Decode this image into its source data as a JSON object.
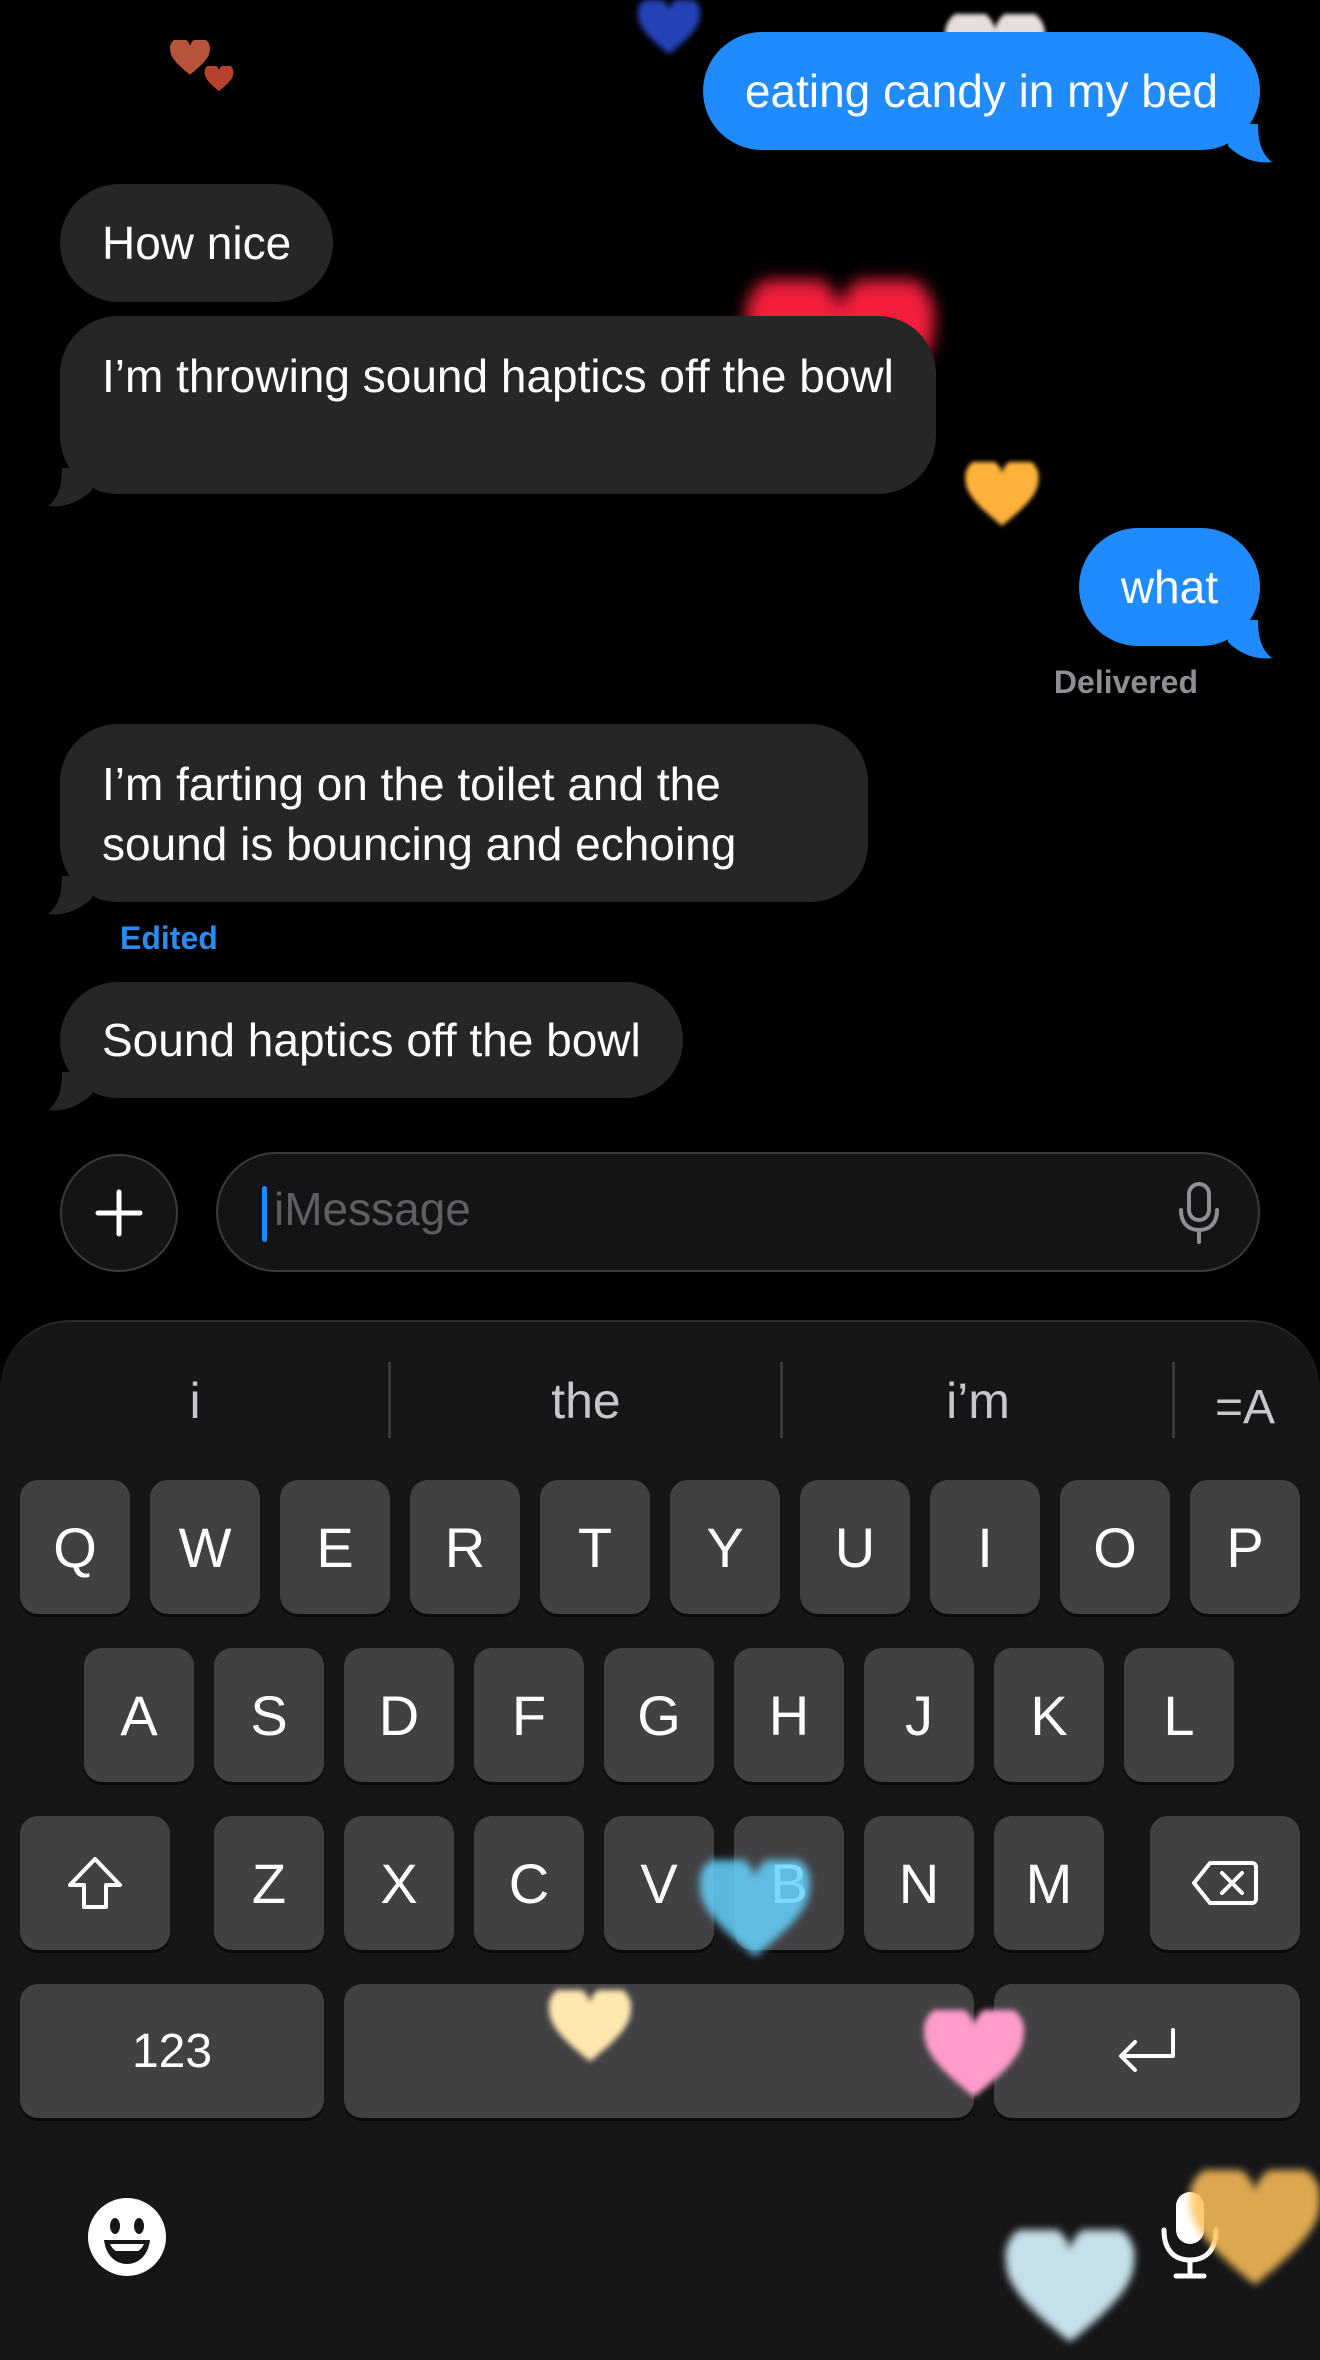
{
  "messages": [
    {
      "direction": "outgoing",
      "text": "eating candy in my bed"
    },
    {
      "direction": "incoming",
      "text": "How nice"
    },
    {
      "direction": "incoming",
      "text": "I’m throwing sound haptics off the bowl"
    },
    {
      "direction": "outgoing",
      "text": "what"
    },
    {
      "direction": "incoming",
      "text": "I’m farting on the toilet and the sound is bouncing and echoing"
    },
    {
      "direction": "incoming",
      "text": "Sound haptics off the bowl"
    }
  ],
  "delivered_label": "Delivered",
  "edited_label": "Edited",
  "compose": {
    "placeholder": "iMessage",
    "plus_icon": "plus-icon",
    "mic_icon": "microphone-icon"
  },
  "keyboard": {
    "suggestions": [
      "i",
      "the",
      "i’m"
    ],
    "format_icon_label": "=A",
    "row1": [
      "Q",
      "W",
      "E",
      "R",
      "T",
      "Y",
      "U",
      "I",
      "O",
      "P"
    ],
    "row2": [
      "A",
      "S",
      "D",
      "F",
      "G",
      "H",
      "J",
      "K",
      "L"
    ],
    "row3": [
      "Z",
      "X",
      "C",
      "V",
      "B",
      "N",
      "M"
    ],
    "numbers_label": "123",
    "shift_icon": "shift-icon",
    "delete_icon": "delete-icon",
    "return_icon": "return-icon",
    "emoji_icon": "emoji-icon",
    "dictation_icon": "microphone-icon"
  },
  "colors": {
    "outgoing_bubble": "#1f8bff",
    "incoming_bubble": "#262628",
    "edited_text": "#2a8cf0",
    "delivered_text": "#8e8e93"
  },
  "effect": "hearts"
}
